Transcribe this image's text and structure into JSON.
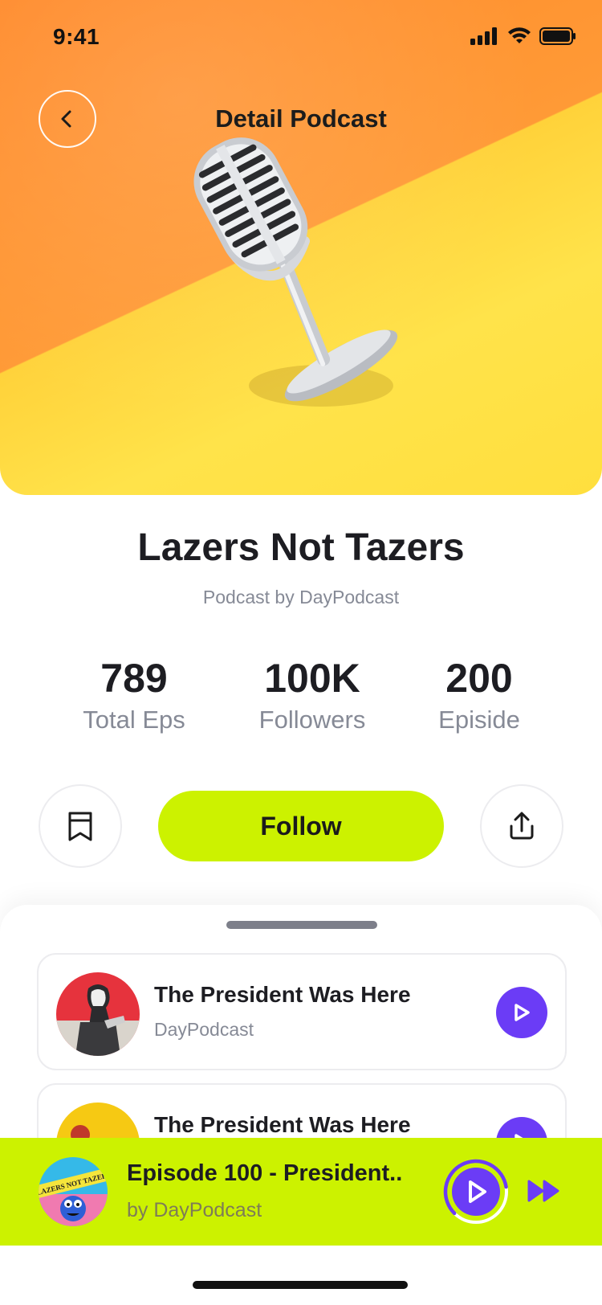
{
  "status_bar": {
    "time": "9:41"
  },
  "header": {
    "title": "Detail Podcast"
  },
  "podcast": {
    "title": "Lazers Not Tazers",
    "subtitle": "Podcast by DayPodcast"
  },
  "stats": [
    {
      "value": "789",
      "label": "Total Eps"
    },
    {
      "value": "100K",
      "label": "Followers"
    },
    {
      "value": "200",
      "label": "Episide"
    }
  ],
  "actions": {
    "follow_label": "Follow"
  },
  "episodes": [
    {
      "title": "The President Was Here",
      "author": "DayPodcast"
    },
    {
      "title": "The President Was Here",
      "author": ""
    }
  ],
  "mini_player": {
    "title": "Episode 100 - President..",
    "author": "by DayPodcast",
    "art_text": "LAZERS NOT TAZERS",
    "progress": 0.6
  },
  "colors": {
    "accent": "#ccf200",
    "play": "#6b3cf6",
    "hero_orange": "#ff8a2a",
    "hero_yellow": "#ffe34a"
  },
  "icons": [
    "back-arrow-icon",
    "signal-icon",
    "wifi-icon",
    "battery-icon",
    "bookmark-icon",
    "share-icon",
    "play-icon",
    "skip-forward-icon"
  ]
}
